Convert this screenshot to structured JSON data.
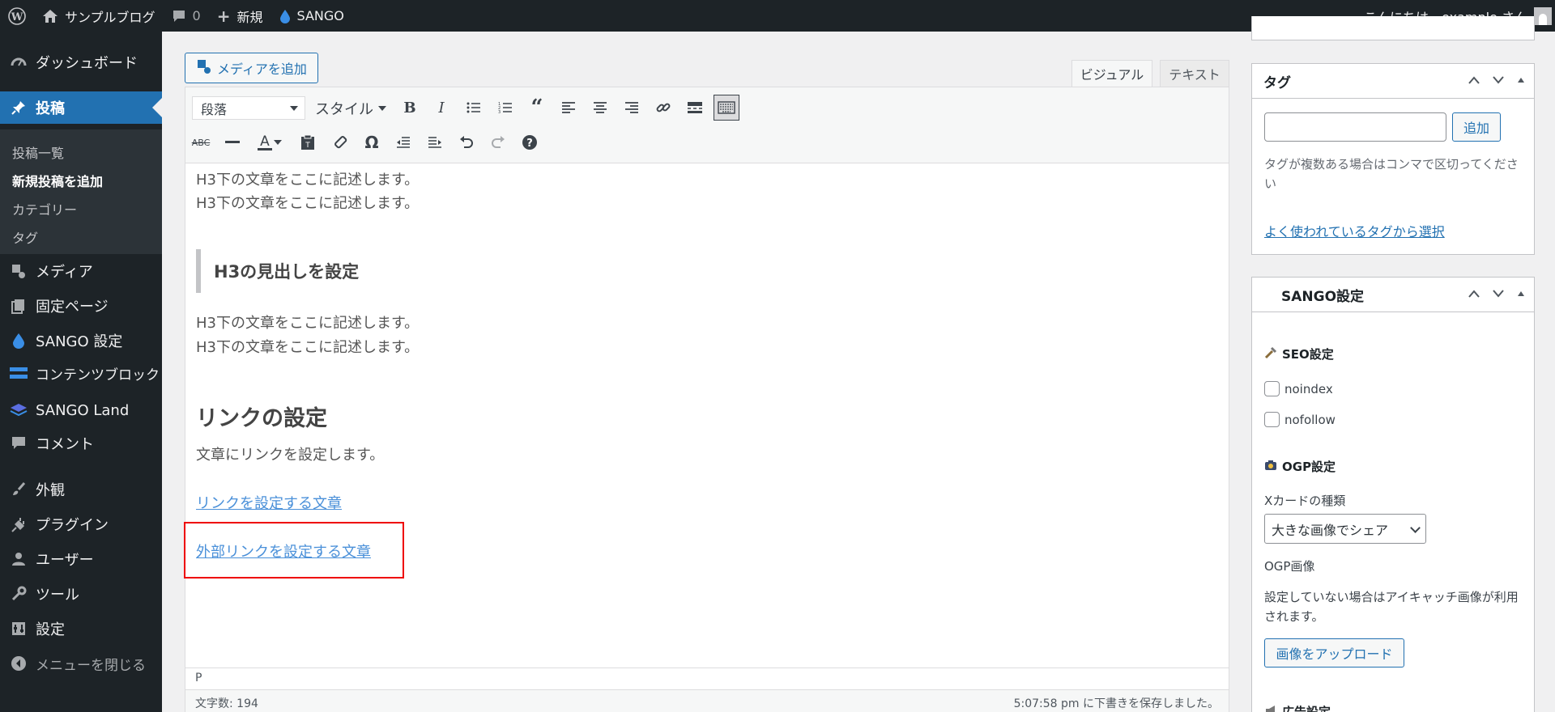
{
  "adminbar": {
    "site_name": "サンプルブログ",
    "comments_count": "0",
    "new_label": "新規",
    "sango_label": "SANGO",
    "greeting": "こんにちは、example さん"
  },
  "sidebar": {
    "items": [
      {
        "label": "ダッシュボード",
        "icon": "dashboard-icon"
      },
      {
        "label": "投稿",
        "icon": "pin-icon"
      },
      {
        "label": "メディア",
        "icon": "media-icon"
      },
      {
        "label": "固定ページ",
        "icon": "page-icon"
      },
      {
        "label": "SANGO 設定",
        "icon": "droplet-icon"
      },
      {
        "label": "コンテンツブロック",
        "icon": "block-icon"
      },
      {
        "label": "SANGO Land",
        "icon": "layers-icon"
      },
      {
        "label": "コメント",
        "icon": "comment-icon"
      },
      {
        "label": "外観",
        "icon": "brush-icon"
      },
      {
        "label": "プラグイン",
        "icon": "plugin-icon"
      },
      {
        "label": "ユーザー",
        "icon": "user-icon"
      },
      {
        "label": "ツール",
        "icon": "wrench-icon"
      },
      {
        "label": "設定",
        "icon": "settings-icon"
      }
    ],
    "submenu": [
      "投稿一覧",
      "新規投稿を追加",
      "カテゴリー",
      "タグ"
    ],
    "collapse_label": "メニューを閉じる"
  },
  "editor": {
    "add_media_label": "メディアを追加",
    "tab_visual": "ビジュアル",
    "tab_text": "テキスト",
    "format_select": "段落",
    "style_select": "スタイル",
    "content": {
      "p1": "H3下の文章をここに記述します。",
      "p2": "H3下の文章をここに記述します。",
      "h3": "H3の見出しを設定",
      "p3": "H3下の文章をここに記述します。",
      "p4": "H3下の文章をここに記述します。",
      "h2": "リンクの設定",
      "p5": "文章にリンクを設定します。",
      "link1": "リンクを設定する文章",
      "link2": "外部リンクを設定する文章"
    },
    "path": "P",
    "word_count": "文字数: 194",
    "autosave": "5:07:58 pm に下書きを保存しました。"
  },
  "tags_panel": {
    "title": "タグ",
    "add_label": "追加",
    "help": "タグが複数ある場合はコンマで区切ってください",
    "popular_link": "よく使われているタグから選択"
  },
  "sango_panel": {
    "title": "SANGO設定",
    "seo_title": "SEO設定",
    "noindex": "noindex",
    "nofollow": "nofollow",
    "ogp_title": "OGP設定",
    "xcard_label": "Xカードの種類",
    "xcard_value": "大きな画像でシェア",
    "ogp_image_label": "OGP画像",
    "ogp_help": "設定していない場合はアイキャッチ画像が利用されます。",
    "upload_label": "画像をアップロード",
    "ad_title": "広告設定"
  },
  "colors": {
    "adminbar": "#1d2327",
    "accent": "#2271b1",
    "highlight": "#e00000"
  }
}
